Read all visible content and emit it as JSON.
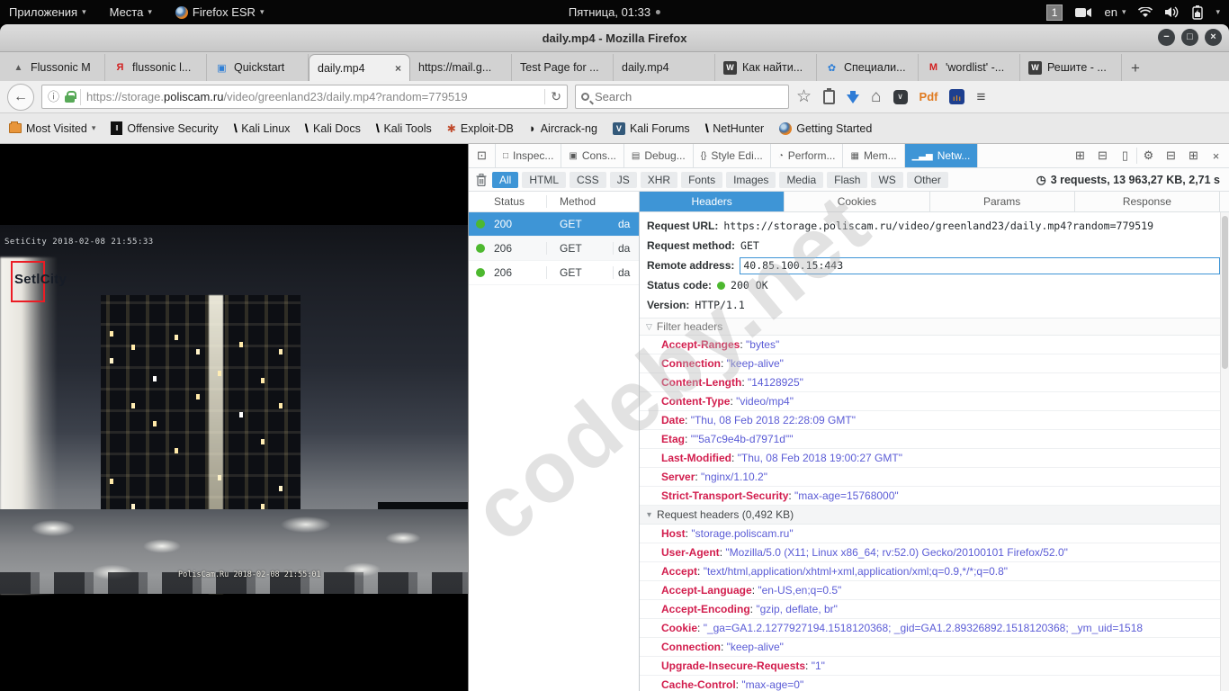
{
  "system_bar": {
    "apps_menu": "Приложения",
    "places_menu": "Места",
    "firefox_menu": "Firefox ESR",
    "clock": "Пятница, 01:33",
    "workspace": "1",
    "keyboard_layout": "en"
  },
  "window": {
    "title": "daily.mp4 - Mozilla Firefox"
  },
  "tab_strip": {
    "tabs": [
      {
        "label": "Flussonic M"
      },
      {
        "label": "flussonic l..."
      },
      {
        "label": "Quickstart"
      },
      {
        "label": "daily.mp4"
      },
      {
        "label": "https://mail.g..."
      },
      {
        "label": "Test Page for ..."
      },
      {
        "label": "daily.mp4"
      },
      {
        "label": "Как найти..."
      },
      {
        "label": "Специали..."
      },
      {
        "label": "'wordlist' -..."
      },
      {
        "label": "Решите - ..."
      }
    ]
  },
  "navbar": {
    "url_prefix": "https://storage.",
    "url_domain": "poliscam.ru",
    "url_suffix": "/video/greenland23/daily.mp4?random=779519",
    "search_placeholder": "Search"
  },
  "bookmarks": [
    {
      "label": "Most Visited"
    },
    {
      "label": "Offensive Security"
    },
    {
      "label": "Kali Linux"
    },
    {
      "label": "Kali Docs"
    },
    {
      "label": "Kali Tools"
    },
    {
      "label": "Exploit-DB"
    },
    {
      "label": "Aircrack-ng"
    },
    {
      "label": "Kali Forums"
    },
    {
      "label": "NetHunter"
    },
    {
      "label": "Getting Started"
    }
  ],
  "video": {
    "osd_top": "SetiCity 2018-02-08 21:55:33",
    "logo": "SetlCity",
    "osd_bottom": "PolisCam.Ru 2018-02-08 21:55:01"
  },
  "watermark": "codeby.net",
  "devtools": {
    "tabs": [
      {
        "label": "Inspec..."
      },
      {
        "label": "Cons..."
      },
      {
        "label": "Debug..."
      },
      {
        "label": "Style Edi..."
      },
      {
        "label": "Perform..."
      },
      {
        "label": "Mem..."
      },
      {
        "label": "Netw..."
      }
    ],
    "filters": [
      "All",
      "HTML",
      "CSS",
      "JS",
      "XHR",
      "Fonts",
      "Images",
      "Media",
      "Flash",
      "WS",
      "Other"
    ],
    "summary": "3 requests, 13 963,27 KB, 2,71 s",
    "request_columns": {
      "status": "Status",
      "method": "Method"
    },
    "requests": [
      {
        "status": "200",
        "method": "GET",
        "file": "da"
      },
      {
        "status": "206",
        "method": "GET",
        "file": "da"
      },
      {
        "status": "206",
        "method": "GET",
        "file": "da"
      }
    ],
    "detail_tabs": [
      "Headers",
      "Cookies",
      "Params",
      "Response"
    ],
    "summary_rows": [
      {
        "label": "Request URL:",
        "value": "https://storage.poliscam.ru/video/greenland23/daily.mp4?random=779519"
      },
      {
        "label": "Request method:",
        "value": "GET"
      },
      {
        "label": "Remote address:",
        "value": "40.85.100.15:443"
      },
      {
        "label": "Status code:",
        "value": "200 OK"
      },
      {
        "label": "Version:",
        "value": "HTTP/1.1"
      }
    ],
    "filter_headers_placeholder": "Filter headers",
    "response_headers": [
      {
        "name": "Accept-Ranges",
        "value": "\"bytes\""
      },
      {
        "name": "Connection",
        "value": "\"keep-alive\""
      },
      {
        "name": "Content-Length",
        "value": "\"14128925\""
      },
      {
        "name": "Content-Type",
        "value": "\"video/mp4\""
      },
      {
        "name": "Date",
        "value": "\"Thu, 08 Feb 2018 22:28:09 GMT\""
      },
      {
        "name": "Etag",
        "value": "\"\"5a7c9e4b-d7971d\"\""
      },
      {
        "name": "Last-Modified",
        "value": "\"Thu, 08 Feb 2018 19:00:27 GMT\""
      },
      {
        "name": "Server",
        "value": "\"nginx/1.10.2\""
      },
      {
        "name": "Strict-Transport-Security",
        "value": "\"max-age=15768000\""
      }
    ],
    "request_headers_group": "Request headers (0,492 KB)",
    "request_headers": [
      {
        "name": "Host",
        "value": "\"storage.poliscam.ru\""
      },
      {
        "name": "User-Agent",
        "value": "\"Mozilla/5.0 (X11; Linux x86_64; rv:52.0) Gecko/20100101 Firefox/52.0\""
      },
      {
        "name": "Accept",
        "value": "\"text/html,application/xhtml+xml,application/xml;q=0.9,*/*;q=0.8\""
      },
      {
        "name": "Accept-Language",
        "value": "\"en-US,en;q=0.5\""
      },
      {
        "name": "Accept-Encoding",
        "value": "\"gzip, deflate, br\""
      },
      {
        "name": "Cookie",
        "value": "\"_ga=GA1.2.1277927194.1518120368; _gid=GA1.2.89326892.1518120368; _ym_uid=1518"
      },
      {
        "name": "Connection",
        "value": "\"keep-alive\""
      },
      {
        "name": "Upgrade-Insecure-Requests",
        "value": "\"1\""
      },
      {
        "name": "Cache-Control",
        "value": "\"max-age=0\""
      }
    ]
  },
  "icons": {
    "back": "←",
    "reload": "↻",
    "info": "ⓘ",
    "star": "☆",
    "home": "⌂",
    "hamburger": "≡",
    "new_tab": "+",
    "close_tab": "×",
    "min": "−",
    "max": "□",
    "close_win": "×",
    "chevron": "▾",
    "yandex": "Я",
    "gmail": "M",
    "wiki": "W",
    "pocket_v": "∨",
    "flussonic": "▲",
    "quickstart": "▣",
    "butterfly": "✿",
    "picker": "⊡",
    "inspector": "□",
    "console": "▣",
    "debugger": "▤",
    "style_editor": "{}",
    "performance": "◔",
    "memory": "▦",
    "network": "▁▃▅",
    "frame_select": "⊞",
    "console_split": "⊟",
    "responsive": "▯",
    "settings": "⚙",
    "dock_bottom": "⊟",
    "dock_window": "⊞",
    "close_tools": "×",
    "clock_glyph": "◷",
    "funnel": "▽",
    "group_arrow": "▾",
    "dagger": "\\",
    "exploit": "✱",
    "bird": "◗",
    "forum_v": "V",
    "offsec_bar": "‖",
    "kali_v": "V",
    "pdf": "Pdf",
    "stats": "ılı"
  }
}
